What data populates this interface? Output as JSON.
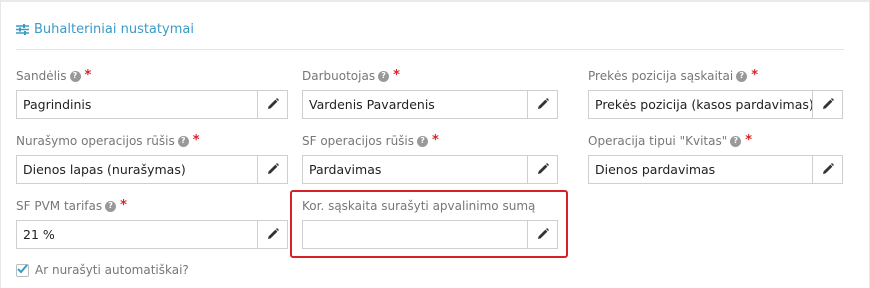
{
  "section": {
    "title": "Buhalteriniai nustatymai",
    "icon": "sliders-icon",
    "accent": "#3a9bc8"
  },
  "fields": [
    {
      "label": "Sandėlis",
      "value": "Pagrindinis",
      "required": "*"
    },
    {
      "label": "Darbuotojas",
      "value": "Vardenis Pavardenis",
      "required": "*"
    },
    {
      "label": "Prekės pozicija sąskaitai",
      "value": "Prekės pozicija (kasos pardavimas)",
      "required": "*"
    },
    {
      "label": "Nurašymo operacijos rūšis",
      "value": "Dienos lapas (nurašymas)",
      "required": "*"
    },
    {
      "label": "SF operacijos rūšis",
      "value": "Pardavimas",
      "required": "*"
    },
    {
      "label": "Operacija tipui \"Kvitas\"",
      "value": "Dienos pardavimas",
      "required": "*"
    },
    {
      "label": "SF PVM tarifas",
      "value": "21 %",
      "required": "*"
    },
    {
      "label": "Kor. sąskaita surašyti apvalinimo sumą",
      "value": ""
    }
  ],
  "help_glyph": "?",
  "auto_writeoff": {
    "label": "Ar nurašyti automatiškai?",
    "checked": true
  },
  "colors": {
    "required": "#d9232d",
    "highlight": "#d42228"
  }
}
